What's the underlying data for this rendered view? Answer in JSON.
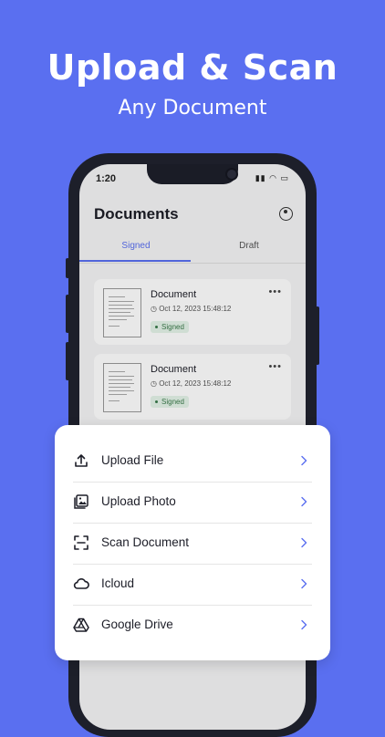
{
  "hero": {
    "title": "Upload & Scan",
    "subtitle": "Any Document"
  },
  "phone": {
    "status": {
      "time": "1:20",
      "icons": "▮▮ ◠ ▭"
    },
    "app_title": "Documents",
    "tabs": [
      {
        "label": "Signed",
        "active": true
      },
      {
        "label": "Draft",
        "active": false
      }
    ],
    "documents": [
      {
        "name": "Document",
        "date": "Oct 12, 2023 15:48:12",
        "status": "Signed",
        "menu": "•••"
      },
      {
        "name": "Document",
        "date": "Oct 12, 2023 15:48:12",
        "status": "Signed",
        "menu": "•••"
      }
    ]
  },
  "sheet": {
    "accent": "#5a6ff0",
    "items": [
      {
        "label": "Upload File",
        "icon": "upload-icon"
      },
      {
        "label": "Upload Photo",
        "icon": "photo-icon"
      },
      {
        "label": "Scan Document",
        "icon": "scan-icon"
      },
      {
        "label": "Icloud",
        "icon": "cloud-icon"
      },
      {
        "label": "Google Drive",
        "icon": "google-drive-icon"
      }
    ]
  }
}
